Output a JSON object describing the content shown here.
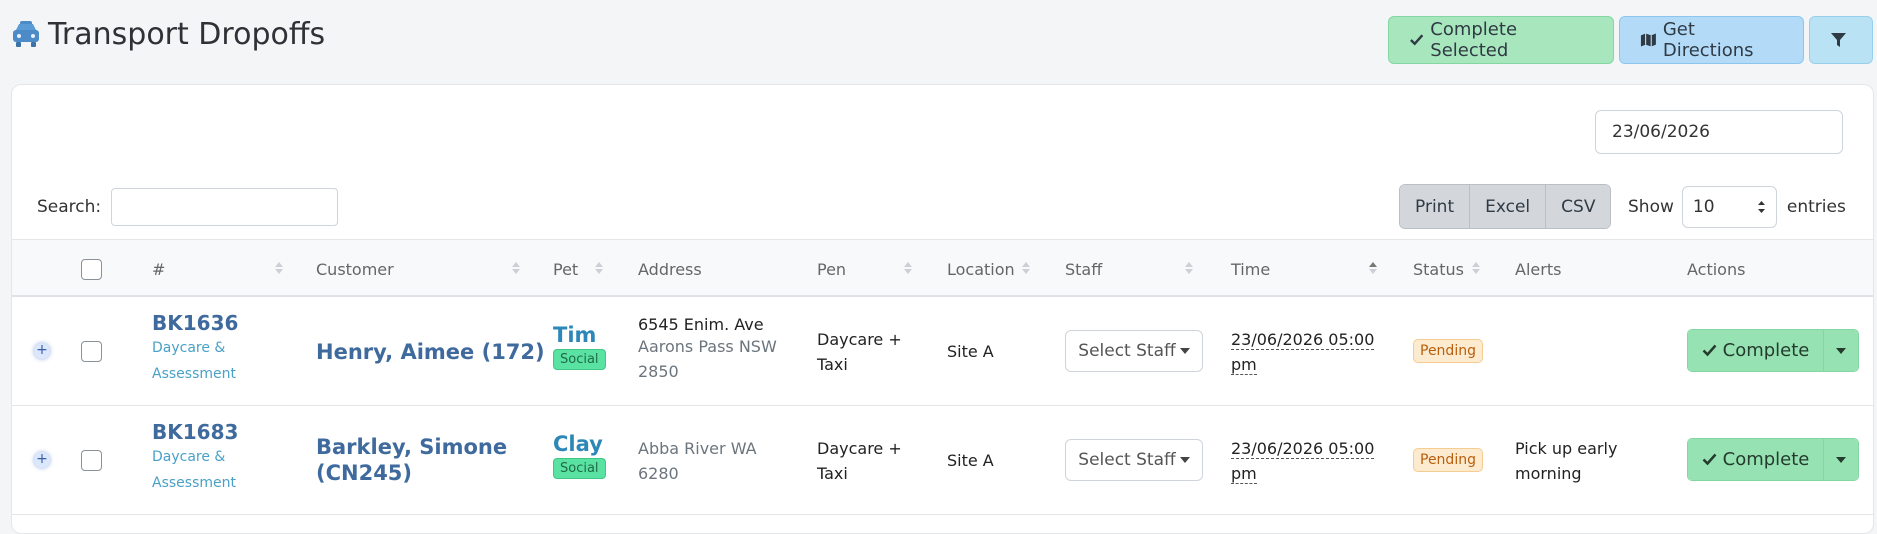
{
  "page": {
    "title": "Transport Dropoffs",
    "icon": "taxi-icon"
  },
  "toolbar": {
    "complete_selected": "Complete Selected",
    "get_directions": "Get Directions",
    "filter_icon": "filter-icon"
  },
  "filters": {
    "date": "23/06/2026",
    "search_label": "Search:",
    "search_value": "",
    "export_buttons": [
      "Print",
      "Excel",
      "CSV"
    ],
    "show_label": "Show",
    "entries_value": "10",
    "entries_label": "entries"
  },
  "table": {
    "columns": [
      "#",
      "Customer",
      "Pet",
      "Address",
      "Pen",
      "Location",
      "Staff",
      "Time",
      "Status",
      "Alerts",
      "Actions"
    ],
    "rows": [
      {
        "booking": "BK1636",
        "service": [
          "Daycare &",
          "Assessment"
        ],
        "customer": [
          "Henry, Aimee (172)"
        ],
        "pet": "Tim",
        "pet_tag": "Social",
        "address_line": "6545 Enim. Ave",
        "address": [
          "Aarons Pass NSW",
          "2850"
        ],
        "pen": [
          "Daycare +",
          "Taxi"
        ],
        "location": "Site A",
        "staff": "Select Staff",
        "time": [
          "23/06/2026 05:00",
          "pm"
        ],
        "status": "Pending",
        "alerts": [
          "",
          ""
        ],
        "action": "Complete"
      },
      {
        "booking": "BK1683",
        "service": [
          "Daycare &",
          "Assessment"
        ],
        "customer": [
          "Barkley, Simone",
          "(CN245)"
        ],
        "pet": "Clay",
        "pet_tag": "Social",
        "address_line": "",
        "address": [
          "Abba River WA",
          "6280"
        ],
        "pen": [
          "Daycare +",
          "Taxi"
        ],
        "location": "Site A",
        "staff": "Select Staff",
        "time": [
          "23/06/2026 05:00",
          "pm"
        ],
        "status": "Pending",
        "alerts": [
          "Pick up early",
          "morning"
        ],
        "action": "Complete"
      }
    ]
  },
  "colors": {
    "accent_green": "#97e2b3",
    "accent_blue": "#b3dbf8",
    "link_blue": "#3f6a9d",
    "pending_orange": "#fdebcf"
  }
}
